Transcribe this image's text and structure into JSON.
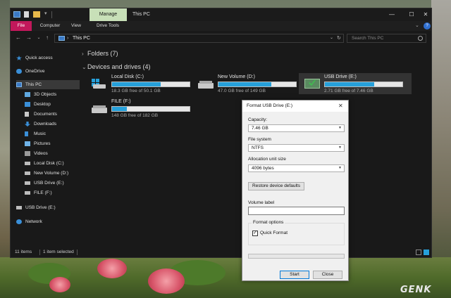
{
  "window": {
    "title_tab": "Manage",
    "title": "This PC",
    "controls": {
      "minimize": "—",
      "maximize": "☐",
      "close": "✕"
    }
  },
  "ribbon": {
    "tabs": [
      "File",
      "Computer",
      "View",
      "Drive Tools"
    ],
    "collapse_glyph": "⌄",
    "help_glyph": "?"
  },
  "address": {
    "back_glyph": "←",
    "forward_glyph": "→",
    "history_glyph": "⌄",
    "up_glyph": "↑",
    "chevron_glyph": "›",
    "path": "This PC",
    "dropdown_glyph": "⌄",
    "refresh_glyph": "↻",
    "search_placeholder": "Search This PC"
  },
  "sidebar": {
    "items": [
      {
        "label": "Quick access",
        "icon": "star-icon"
      },
      {
        "label": "OneDrive",
        "icon": "cloud-icon"
      },
      {
        "label": "This PC",
        "icon": "computer-icon",
        "selected": true
      },
      {
        "label": "3D Objects",
        "icon": "cube-icon"
      },
      {
        "label": "Desktop",
        "icon": "desktop-icon"
      },
      {
        "label": "Documents",
        "icon": "documents-icon"
      },
      {
        "label": "Downloads",
        "icon": "download-icon"
      },
      {
        "label": "Music",
        "icon": "music-icon"
      },
      {
        "label": "Pictures",
        "icon": "pictures-icon"
      },
      {
        "label": "Videos",
        "icon": "videos-icon"
      },
      {
        "label": "Local Disk (C:)",
        "icon": "drive-icon"
      },
      {
        "label": "New Volume (D:)",
        "icon": "drive-icon"
      },
      {
        "label": "USB Drive (E:)",
        "icon": "usb-drive-icon"
      },
      {
        "label": "FILE (F:)",
        "icon": "drive-icon"
      },
      {
        "label": "USB Drive (E:)",
        "icon": "usb-drive-icon"
      },
      {
        "label": "Network",
        "icon": "network-icon"
      }
    ]
  },
  "main": {
    "folders_group": "Folders (7)",
    "devices_group": "Devices and drives (4)",
    "drives": [
      {
        "name": "Local Disk (C:)",
        "free_text": "18.3 GB free of 50.1 GB",
        "used_fraction": 0.63,
        "icon": "windows-drive-icon"
      },
      {
        "name": "New Volume (D:)",
        "free_text": "47.0 GB free of 149 GB",
        "used_fraction": 0.68,
        "icon": "hard-drive-icon"
      },
      {
        "name": "USB Drive (E:)",
        "free_text": "2.71 GB free of 7.46 GB",
        "used_fraction": 0.64,
        "icon": "usb-drive-icon",
        "selected": true
      },
      {
        "name": "FILE (F:)",
        "free_text": "148 GB free of 182 GB",
        "used_fraction": 0.19,
        "icon": "hard-drive-icon"
      }
    ]
  },
  "status": {
    "items_count": "11 items",
    "selected": "1 item selected"
  },
  "dialog": {
    "title": "Format USB Drive (E:)",
    "close_glyph": "✕",
    "capacity_label": "Capacity:",
    "capacity_value": "7.46 GB",
    "filesystem_label": "File system",
    "filesystem_value": "NTFS",
    "allocation_label": "Allocation unit size",
    "allocation_value": "4096 bytes",
    "select_arrow": "▼",
    "restore_button": "Restore device defaults",
    "volume_label": "Volume label",
    "volume_value": "",
    "format_options_title": "Format options",
    "quick_format_label": "Quick Format",
    "quick_format_checked": "✓",
    "progress_fraction": 0,
    "start_button": "Start",
    "close_button": "Close"
  },
  "watermark": "GENK",
  "colors": {
    "accent_blue": "#26a0da",
    "file_tab": "#c2185b",
    "manage_tab": "#c8e0b8",
    "window_bg": "#191919"
  }
}
